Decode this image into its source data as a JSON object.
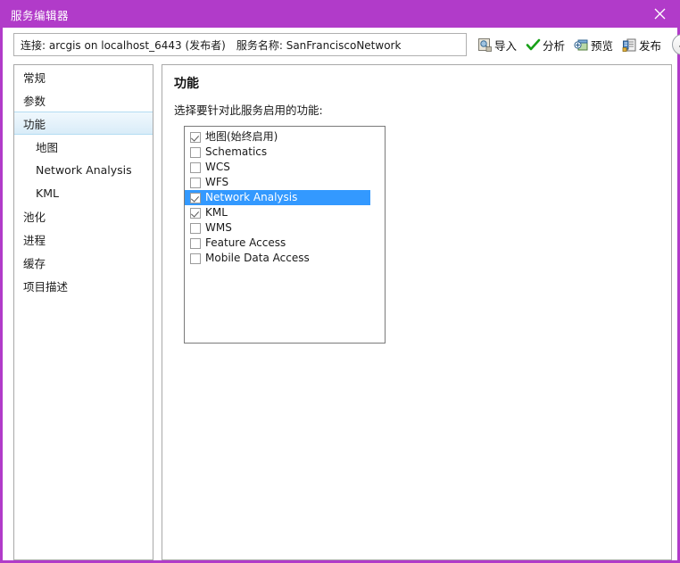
{
  "window": {
    "title": "服务编辑器",
    "accent_color": "#b13bc9",
    "close_icon": "close-icon"
  },
  "toolbar": {
    "connection_label": "连接: arcgis on localhost_6443 (发布者)",
    "service_name_label": "服务名称: SanFranciscoNetwork",
    "buttons": [
      {
        "label": "导入",
        "icon": "import-icon"
      },
      {
        "label": "分析",
        "icon": "analyze-check-icon"
      },
      {
        "label": "预览",
        "icon": "preview-icon"
      },
      {
        "label": "发布",
        "icon": "publish-icon"
      }
    ],
    "collapse_icon": "chevron-up-icon"
  },
  "sidebar": {
    "items": [
      {
        "label": "常规",
        "level": 0,
        "selected": false
      },
      {
        "label": "参数",
        "level": 0,
        "selected": false
      },
      {
        "label": "功能",
        "level": 0,
        "selected": true
      },
      {
        "label": "地图",
        "level": 1,
        "selected": false
      },
      {
        "label": "Network Analysis",
        "level": 1,
        "selected": false
      },
      {
        "label": "KML",
        "level": 1,
        "selected": false
      },
      {
        "label": "池化",
        "level": 0,
        "selected": false
      },
      {
        "label": "进程",
        "level": 0,
        "selected": false
      },
      {
        "label": "缓存",
        "level": 0,
        "selected": false
      },
      {
        "label": "项目描述",
        "level": 0,
        "selected": false
      }
    ]
  },
  "main": {
    "title": "功能",
    "description": "选择要针对此服务启用的功能:",
    "capabilities": [
      {
        "label": "地图(始终启用)",
        "checked": true,
        "selected": false
      },
      {
        "label": "Schematics",
        "checked": false,
        "selected": false
      },
      {
        "label": "WCS",
        "checked": false,
        "selected": false
      },
      {
        "label": "WFS",
        "checked": false,
        "selected": false
      },
      {
        "label": "Network Analysis",
        "checked": true,
        "selected": true
      },
      {
        "label": "KML",
        "checked": true,
        "selected": false
      },
      {
        "label": "WMS",
        "checked": false,
        "selected": false
      },
      {
        "label": "Feature Access",
        "checked": false,
        "selected": false
      },
      {
        "label": "Mobile Data Access",
        "checked": false,
        "selected": false
      }
    ],
    "selection_color": "#3399ff"
  }
}
